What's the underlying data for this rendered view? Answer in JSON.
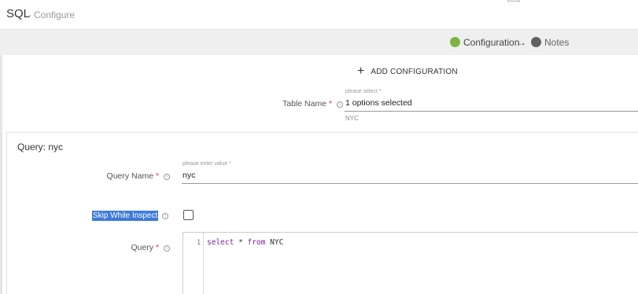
{
  "header": {
    "title": "SQL",
    "separator": "-",
    "subtitle": "Configure"
  },
  "steps": [
    {
      "label": "Configuration",
      "status_color": "#7cb342"
    },
    {
      "label": "Notes",
      "status_color": "#616161"
    }
  ],
  "step_arrow": "→",
  "add_configuration": {
    "icon": "plus-icon",
    "label": "ADD CONFIGURATION"
  },
  "table_name": {
    "label": "Table Name",
    "required": "*",
    "hint": "please select *",
    "value": "1 options selected",
    "selected_options": [
      "NYC"
    ]
  },
  "query_section": {
    "title": "Query: nyc",
    "query_name": {
      "label": "Query Name",
      "required": "*",
      "hint": "please enter value *",
      "value": "nyc"
    },
    "skip_while_inspect": {
      "label": "Skip While Inspect",
      "checked": false
    },
    "query": {
      "label": "Query",
      "required": "*",
      "line_number": "1",
      "tokens": {
        "kw1": "select",
        "star": "*",
        "kw2": "from",
        "table": "NYC"
      }
    }
  },
  "colors": {
    "accent_green": "#7cb342",
    "step_grey": "#616161",
    "highlight_blue": "#3d7bd9",
    "required_red": "#e53935",
    "keyword_purple": "#7b1fa2"
  }
}
